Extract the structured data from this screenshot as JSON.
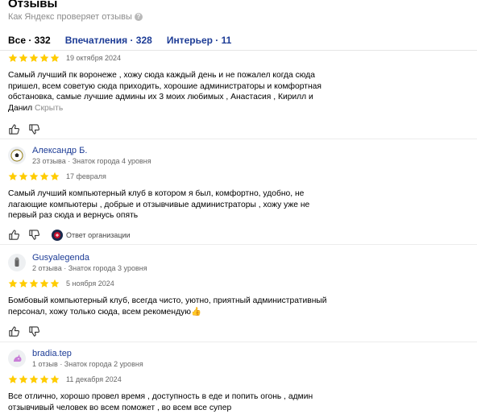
{
  "header": {
    "title": "Отзывы",
    "subtitle": "Как Яндекс проверяет отзывы",
    "info_icon": "question-circle-icon"
  },
  "tabs": [
    {
      "label": "Все · 332",
      "active": true
    },
    {
      "label": "Впечатления · 328",
      "active": false
    },
    {
      "label": "Интерьер · 11",
      "active": false
    }
  ],
  "colors": {
    "star": "#fc0",
    "link": "#1d3c96",
    "muted": "#8c8c8c"
  },
  "reviews": [
    {
      "rating": 5,
      "date": "19 октября 2024",
      "text": "Самый лучший пк воронеже , хожу сюда каждый день и не пожалел когда сюда пришел, всем советую сюда приходить, хорошие администраторы и комфортная обстановка, самые лучшие админы их 3 моих любимых , Анастасия , Кирилл и Данил",
      "hide_label": "Скрыть"
    },
    {
      "author": "Александр Б.",
      "author_info": "23 отзыва · Знаток города 4 уровня",
      "avatar_icon": "soccer-ball-avatar",
      "rating": 5,
      "date": "17 февраля",
      "text": "Самый лучший компьютерный клуб в котором я был, комфортно, удобно, не лагающие компьютеры , добрые и отзывчивые администраторы , хожу уже не первый раз сюда и вернусь опять",
      "org_reply": "Ответ организации"
    },
    {
      "author": "Gusyalegenda",
      "author_info": "2 отзыва · Знаток города 3 уровня",
      "avatar_icon": "figure-avatar",
      "rating": 5,
      "date": "5 ноября 2024",
      "text": "Бомбовый компьютерный клуб, всегда чисто, уютно, приятный административный персонал, хожу только сюда, всем рекомендую👍"
    },
    {
      "author": "bradia.tep",
      "author_info": "1 отзыв · Знаток города 2 уровня",
      "avatar_icon": "unicorn-avatar",
      "rating": 5,
      "date": "11 декабря 2024",
      "text": "Все отлично, хорошо провел время , доступность в еде и попить огонь , админ отзывчивый человек во всем поможет , во всем все супер"
    }
  ]
}
